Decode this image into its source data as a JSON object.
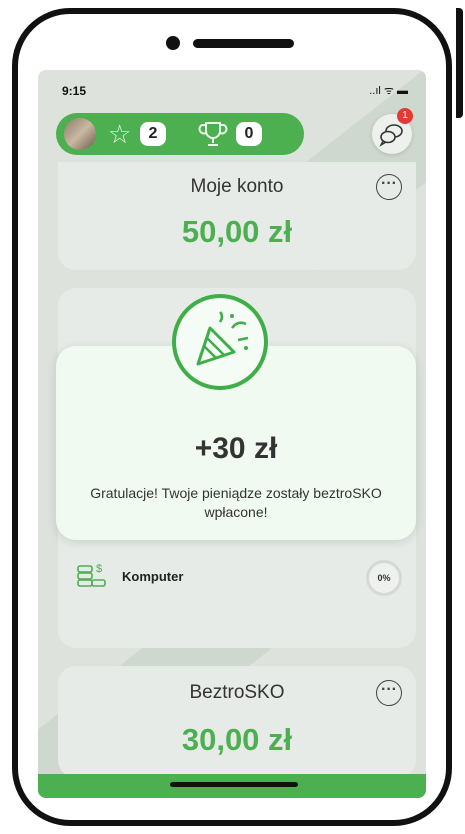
{
  "status": {
    "time": "9:15",
    "icons": "..ıl ᯤ ▬"
  },
  "header": {
    "stars": "2",
    "trophies": "0",
    "notifications": "1"
  },
  "cards": [
    {
      "title": "Moje konto",
      "amount": "50,00 zł"
    },
    {
      "title": "BeztroSKO",
      "amount": "30,00 zł"
    }
  ],
  "goal": {
    "name": "Komputer",
    "percent": "0%"
  },
  "modal": {
    "amount": "+30 zł",
    "message": "Gratulacje! Twoje pieniądze zostały beztroSKO wpłacone!"
  },
  "colors": {
    "accent": "#4caf50",
    "badge": "#e53935"
  },
  "icons": [
    "avatar",
    "star-icon",
    "trophy-icon",
    "chat-icon",
    "more-icon",
    "coins-icon",
    "confetti-icon"
  ]
}
